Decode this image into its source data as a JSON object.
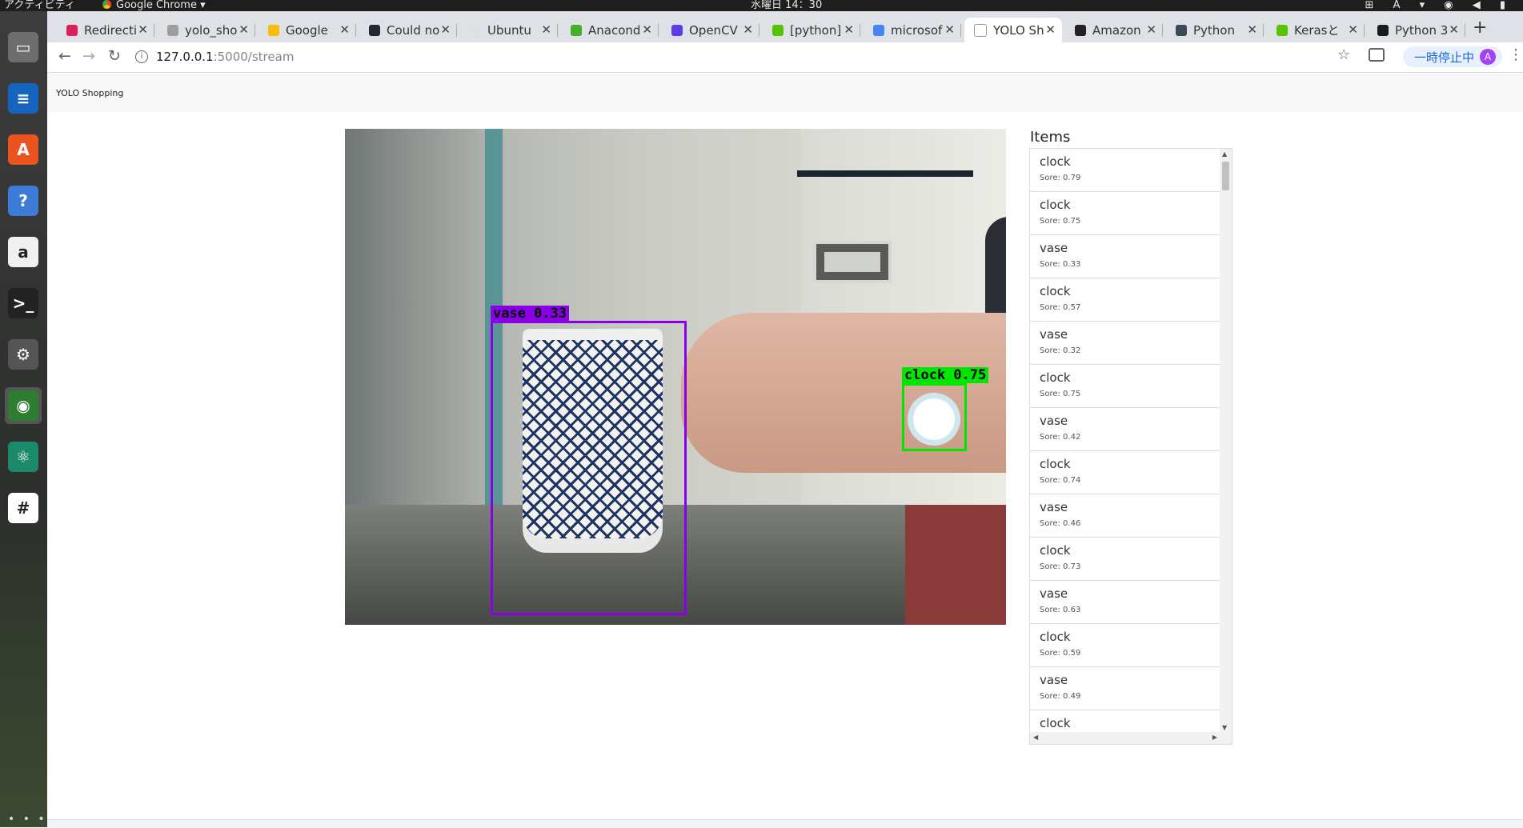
{
  "os": {
    "activities": "アクティビティ",
    "app_name": "Google Chrome ▾",
    "clock": "水曜日 14：30",
    "tray_icons": "⊞ A ▾ ◉ ◀ ▮"
  },
  "dock": {
    "items": [
      {
        "name": "files-icon",
        "glyph": "▭",
        "bg": "#6d6d6d"
      },
      {
        "name": "writer-icon",
        "glyph": "≡",
        "bg": "#1565c0"
      },
      {
        "name": "software-center-icon",
        "glyph": "A",
        "bg": "#e95420"
      },
      {
        "name": "help-icon",
        "glyph": "?",
        "bg": "#3c7bd6"
      },
      {
        "name": "amazon-icon",
        "glyph": "a",
        "bg": "#f0f0f0"
      },
      {
        "name": "terminal-icon",
        "glyph": ">_",
        "bg": "#222"
      },
      {
        "name": "settings-icon",
        "glyph": "⚙",
        "bg": "#555"
      },
      {
        "name": "chrome-icon",
        "glyph": "◉",
        "bg": "#2e7d32"
      },
      {
        "name": "atom-icon",
        "glyph": "⚛",
        "bg": "#1b8a6b"
      },
      {
        "name": "slack-icon",
        "glyph": "#",
        "bg": "#ffffff"
      }
    ],
    "more": "• • •"
  },
  "tabs": [
    {
      "title": "Redirecti",
      "color": "#e01e5a"
    },
    {
      "title": "yolo_sho",
      "color": "#9e9e9e"
    },
    {
      "title": "Google",
      "color": "#fbbc05"
    },
    {
      "title": "Could no",
      "color": "#24292e"
    },
    {
      "title": "Ubuntu",
      "color": "#e0e0e0"
    },
    {
      "title": "Anacond",
      "color": "#43b02a"
    },
    {
      "title": "OpenCV",
      "color": "#5c3ee8"
    },
    {
      "title": "[python]",
      "color": "#55c500"
    },
    {
      "title": "microsof",
      "color": "#4285f4"
    },
    {
      "title": "YOLO Sh",
      "color": "#ffffff",
      "active": true
    },
    {
      "title": "Amazon",
      "color": "#222222"
    },
    {
      "title": "Python",
      "color": "#3b4a56"
    },
    {
      "title": "Kerasと",
      "color": "#55c500"
    },
    {
      "title": "Python 3",
      "color": "#1a1a1a"
    }
  ],
  "toolbar": {
    "url_host": "127.0.0.1",
    "url_path": ":5000/stream",
    "pause_label": "一時停止中",
    "avatar_letter": "A"
  },
  "page": {
    "brand": "YOLO Shopping",
    "items_title": "Items",
    "detections": [
      {
        "label": "vase 0.33",
        "color": "#8a00e6"
      },
      {
        "label": "clock 0.75",
        "color": "#00e600"
      }
    ],
    "items": [
      {
        "name": "clock",
        "score": "Sore: 0.79"
      },
      {
        "name": "clock",
        "score": "Sore: 0.75"
      },
      {
        "name": "vase",
        "score": "Sore: 0.33"
      },
      {
        "name": "clock",
        "score": "Sore: 0.57"
      },
      {
        "name": "vase",
        "score": "Sore: 0.32"
      },
      {
        "name": "clock",
        "score": "Sore: 0.75"
      },
      {
        "name": "vase",
        "score": "Sore: 0.42"
      },
      {
        "name": "clock",
        "score": "Sore: 0.74"
      },
      {
        "name": "vase",
        "score": "Sore: 0.46"
      },
      {
        "name": "clock",
        "score": "Sore: 0.73"
      },
      {
        "name": "vase",
        "score": "Sore: 0.63"
      },
      {
        "name": "clock",
        "score": "Sore: 0.59"
      },
      {
        "name": "vase",
        "score": "Sore: 0.49"
      },
      {
        "name": "clock",
        "score": ""
      }
    ]
  }
}
